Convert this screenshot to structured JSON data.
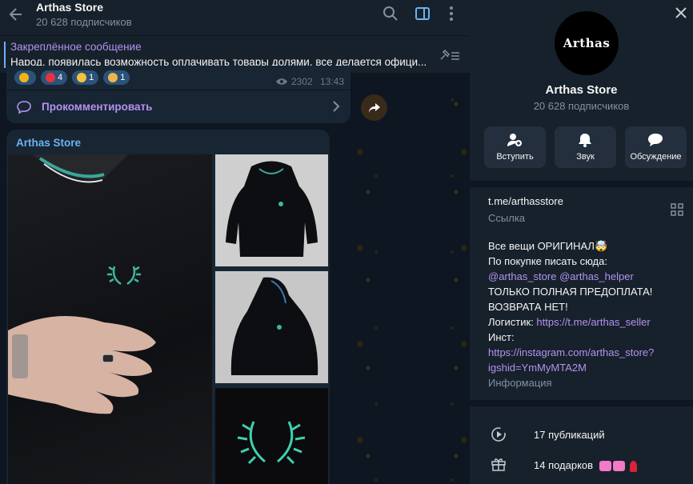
{
  "chat": {
    "header": {
      "title": "Arthas Store",
      "subscribers": "20 628 подписчиков"
    },
    "pinned": {
      "title": "Закреплённое сообщение",
      "text": "Народ, появилась возможность оплачивать товары долями, все делается офици..."
    },
    "message": {
      "reactions": [
        {
          "emoji": "star",
          "count": ""
        },
        {
          "emoji": "heart",
          "count": "4"
        },
        {
          "emoji": "heart-eyes",
          "count": "1"
        },
        {
          "emoji": "handshake",
          "count": "1"
        }
      ],
      "views": "2302",
      "time": "13:43",
      "comment_label": "Прокомментировать"
    },
    "album": {
      "author": "Arthas Store"
    }
  },
  "panel": {
    "avatar_text": "Arthas",
    "title": "Arthas Store",
    "subscribers": "20 628 подписчиков",
    "buttons": [
      {
        "label": "Вступить",
        "icon": "add-user-icon"
      },
      {
        "label": "Звук",
        "icon": "bell-icon"
      },
      {
        "label": "Обсуждение",
        "icon": "chat-bubble-icon"
      }
    ],
    "link": {
      "url": "t.me/arthasstore",
      "caption": "Ссылка"
    },
    "description": {
      "line1": "Все вещи ОРИГИНАЛ🤯",
      "line2": "По покупке писать сюда:",
      "handle1": "@arthas_store",
      "handle2": "@arthas_helper",
      "line4": "ТОЛЬКО ПОЛНАЯ ПРЕДОПЛАТА!",
      "line5": "ВОЗВРАТА НЕТ!",
      "logistics_label": "Логистик: ",
      "logistics_link": "https://t.me/arthas_seller",
      "insta_label": "Инст:",
      "insta_link1": "https://instagram.com/arthas_store?",
      "insta_link2": "igshid=YmMyMTA2M",
      "caption": "Информация"
    },
    "stats": {
      "publications": "17 публикаций",
      "gifts": "14 подарков"
    }
  },
  "colors": {
    "accent": "#6ab2f2",
    "link": "#b392f0",
    "panel_bg": "#17212b",
    "bubble": "#182533"
  }
}
